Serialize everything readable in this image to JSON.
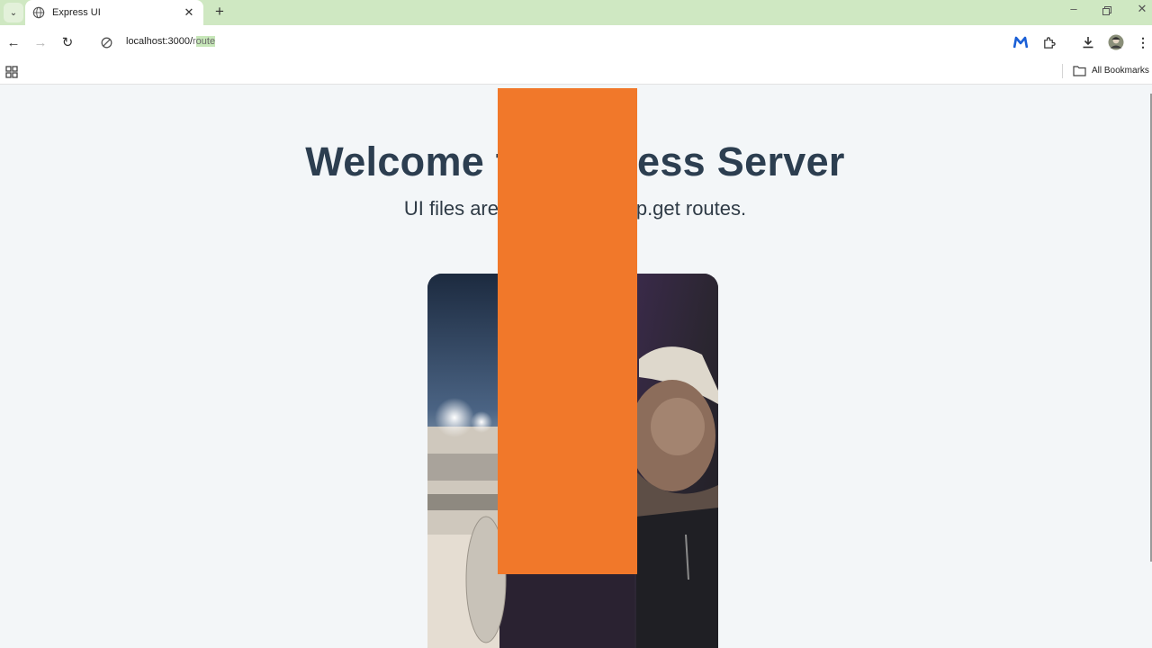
{
  "browser": {
    "tab": {
      "title": "Express UI"
    },
    "address_bar": {
      "host": "localhost:3000/",
      "path_pre": "r",
      "path_hl": "oute"
    },
    "bookmarks": {
      "all_bookmarks_label": "All Bookmarks"
    },
    "colors": {
      "tabstrip": "#cfe8c2",
      "accent_extension": "#1a5fd6"
    }
  },
  "page": {
    "heading": "Welcome to Express Server",
    "subtext": "UI files are served from app.get routes.",
    "video": {
      "icon": "video-frame"
    },
    "overlay_color": "#f1782a"
  }
}
